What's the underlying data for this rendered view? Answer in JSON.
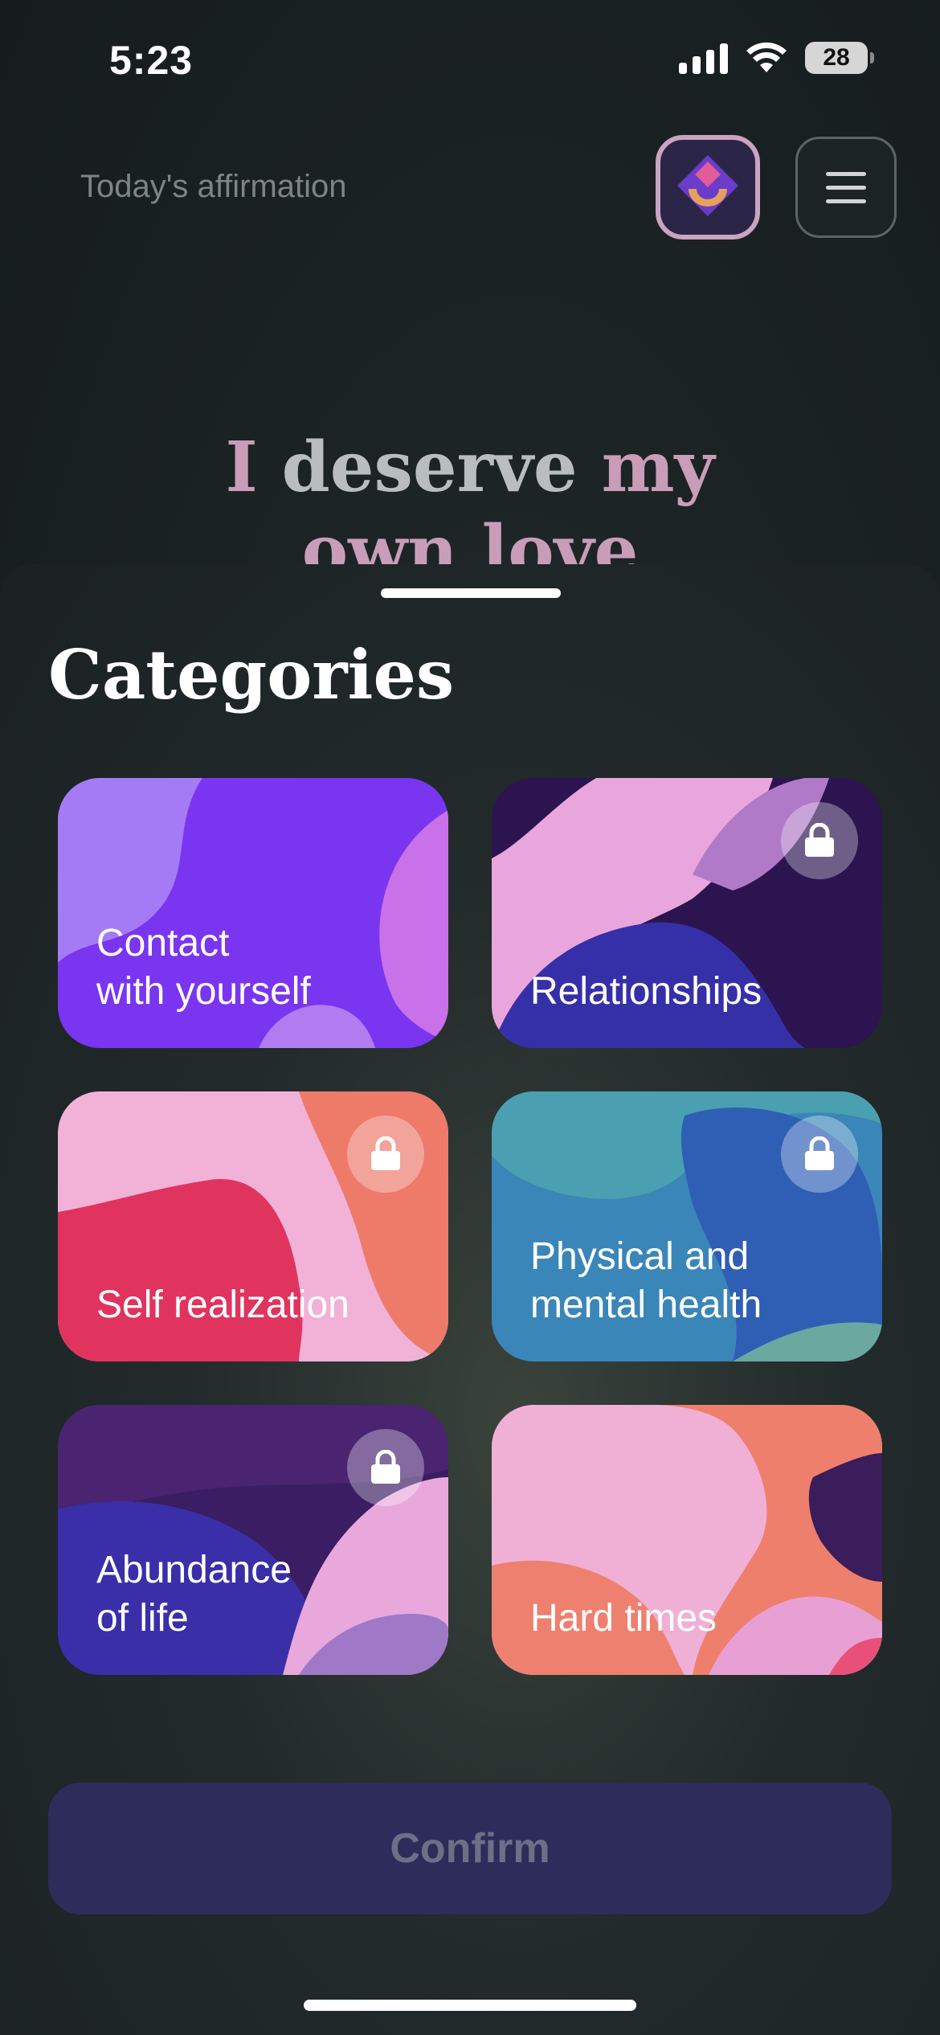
{
  "status_bar": {
    "time": "5:23",
    "battery": "28"
  },
  "header": {
    "todays_label": "Today's affirmation",
    "affirmation_line1_pink": "I",
    "affirmation_line1_rest": " deserve ",
    "affirmation_line1_pink2": "my",
    "affirmation_line2": "own love"
  },
  "sheet": {
    "title": "Categories",
    "cards": [
      {
        "label_line1": "Contact",
        "label_line2": "with yourself",
        "locked": false
      },
      {
        "label_line1": "Relationships",
        "label_line2": "",
        "locked": true
      },
      {
        "label_line1": "Self realization",
        "label_line2": "",
        "locked": true
      },
      {
        "label_line1": "Physical and",
        "label_line2": "mental health",
        "locked": true
      },
      {
        "label_line1": "Abundance",
        "label_line2": "of life",
        "locked": true
      },
      {
        "label_line1": "Hard times",
        "label_line2": "",
        "locked": false
      }
    ],
    "confirm_label": "Confirm"
  },
  "colors": {
    "background": "#1a2123",
    "confirm_bg": "#2d2c5a",
    "confirm_text": "#6e6f86",
    "badge_border": "#caa4c2"
  },
  "icons": [
    "signal-icon",
    "wifi-icon",
    "battery-icon",
    "app-logo-icon",
    "menu-icon",
    "lock-icon"
  ]
}
